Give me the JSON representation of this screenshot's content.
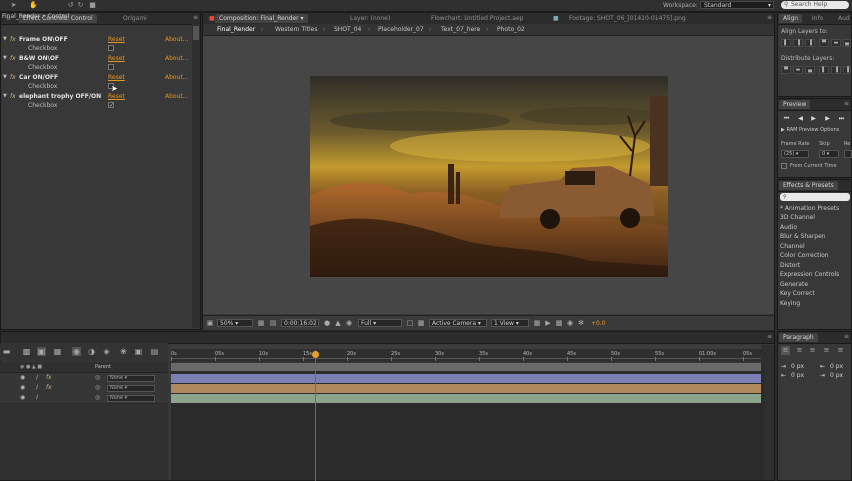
{
  "workspace": {
    "label": "Workspace:",
    "value": "Standard"
  },
  "search": {
    "placeholder": "Search Help"
  },
  "effect_panel": {
    "tabs": [
      "Effect Controls: Control",
      "Origami"
    ],
    "path": "Final_Render • Control",
    "reset_label": "Reset",
    "about_label": "About...",
    "effects": [
      {
        "name": "Frame ON\\OFF",
        "checkbox_label": "Checkbox",
        "checked": false
      },
      {
        "name": "B&W ON\\OF",
        "checkbox_label": "Checkbox",
        "checked": false
      },
      {
        "name": "Car ON/OFF",
        "checkbox_label": "Checkbox",
        "checked": false
      },
      {
        "name": "elephant trophy OFF/ON",
        "checkbox_label": "Checkbox",
        "checked": true
      }
    ]
  },
  "comp_panel": {
    "tabs": [
      "Composition: Final_Render",
      "Layer: (none)",
      "Flowchart: Untitled Project.aep",
      "Footage: SHOT_06_[01410-01475].png"
    ],
    "crumbs": [
      "Final_Render",
      "Western Titles",
      "SHOT_04",
      "Placeholder_07",
      "Text_07_here",
      "Photo_02"
    ],
    "footer": {
      "zoom": "50%",
      "timecode": "0:00:16:02",
      "resolution": "Full",
      "camera": "Active Camera",
      "views": "1 View",
      "exposure": "+0.0"
    }
  },
  "align_panel": {
    "tabs": [
      "Align",
      "Info",
      "Aud"
    ],
    "align_to_label": "Align Layers to:",
    "distribute_label": "Distribute Layers:"
  },
  "preview_panel": {
    "tab": "Preview",
    "ram_options": "RAM Preview Options",
    "frame_rate_label": "Frame Rate",
    "skip_label": "Skip",
    "res_label": "Re",
    "frame_rate_value": "(25)",
    "skip_value": "0",
    "from_current": "From Current Time"
  },
  "effects_presets": {
    "tab": "Effects & Presets",
    "search_placeholder": "",
    "items": [
      "* Animation Presets",
      "3D Channel",
      "Audio",
      "Blur & Sharpen",
      "Channel",
      "Color Correction",
      "Distort",
      "Expression Controls",
      "Generate",
      "Key Correct",
      "Keying"
    ]
  },
  "timeline": {
    "ruler_labels": [
      "0s",
      "05s",
      "10s",
      "15s",
      "20s",
      "25s",
      "30s",
      "35s",
      "40s",
      "45s",
      "50s",
      "55s",
      "01:00s",
      "05s"
    ],
    "column_header": "Parent",
    "layers": [
      {
        "parent": "None",
        "color": "#7b7fb4"
      },
      {
        "parent": "None",
        "color": "#b08a5f"
      },
      {
        "parent": "None",
        "color": "#8aa58b"
      }
    ],
    "playhead_time": 0.27
  },
  "paragraph_panel": {
    "tab": "Paragraph",
    "values": [
      "0 px",
      "0 px",
      "0 px",
      "0 px"
    ]
  }
}
